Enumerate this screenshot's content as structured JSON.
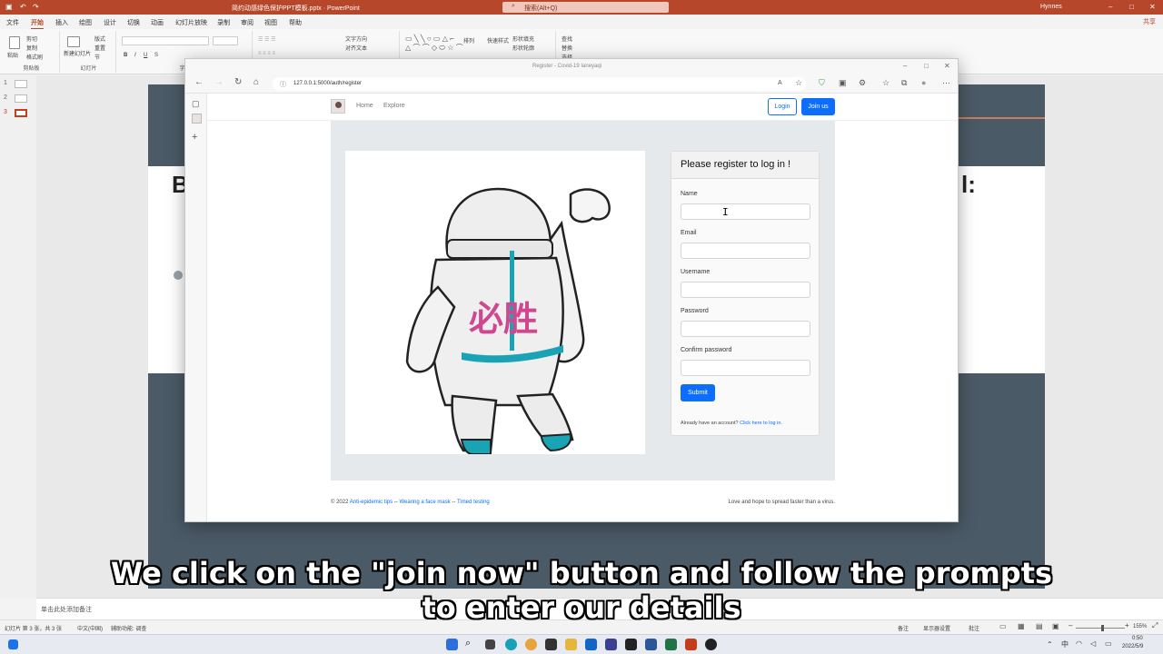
{
  "ppt": {
    "file_title": "简约动感绿色保护PPT模板.pptx  ·  PowerPoint",
    "search_placeholder": "搜索(Alt+Q)",
    "user": "Hynnes",
    "tabs": [
      "文件",
      "开始",
      "插入",
      "绘图",
      "设计",
      "切换",
      "动画",
      "幻灯片放映",
      "录制",
      "审阅",
      "视图",
      "帮助"
    ],
    "active_tab": "开始",
    "share": "共享",
    "ribbon_groups": {
      "clipboard": "剪贴板",
      "slides": "幻灯片",
      "font": "字体"
    },
    "ribbon": {
      "paste": "粘贴",
      "cut": "剪切",
      "copy": "复制",
      "format_painter": "格式刷",
      "new_slide": "新建幻灯片",
      "layout": "版式",
      "reset": "重置",
      "section": "节",
      "find": "查找",
      "replace": "替换",
      "select": "选择",
      "arrange": "排列",
      "quick_styles": "快速样式",
      "text_direction": "文字方向",
      "align_text": "对齐文本",
      "shape_fill": "形状填充",
      "shape_outline": "形状轮廓"
    },
    "slide_numbers": [
      "1",
      "2",
      "3"
    ],
    "slide_partial_left": "B",
    "slide_partial_right": "l:",
    "notes_placeholder": "单击此处添加备注",
    "status_left": "幻灯片 第 3 张，共 3 张",
    "status_lang": "中文(中国)",
    "status_access": "辅助功能: 调查",
    "status_notes": "备注",
    "status_display": "显示器设置",
    "status_comments": "批注",
    "zoom": "155%",
    "clock_time": "0:50",
    "clock_date": "2022/5/9",
    "colors": {
      "titlebar": "#b7472a",
      "slide_dark": "#4a5a66"
    }
  },
  "browser": {
    "window_title": "Register - Covid-19 Ianeyaqi",
    "url": "127.0.0.1:5000/auth/register"
  },
  "site": {
    "nav": {
      "home": "Home",
      "explore": "Explore",
      "login": "Login",
      "join": "Join us"
    },
    "hero_text": "必胜",
    "form": {
      "title": "Please register to log in !",
      "name_label": "Name",
      "email_label": "Email",
      "username_label": "Username",
      "password_label": "Password",
      "confirm_label": "Confirm password",
      "submit": "Submit",
      "already": "Already have an account?",
      "login_link": "Click here to log in."
    },
    "footer": {
      "copyright": "© 2022",
      "link1": "Anti-epidemic tips",
      "sep1": " -- ",
      "link2": "Wearing a face mask",
      "sep2": " -- ",
      "link3": "Timed testing",
      "right": "Love and hope to spread faster than a virus."
    },
    "colors": {
      "primary": "#0d6efd",
      "suit_stripe": "#1aa3b5",
      "hero_text": "#d1478f"
    }
  },
  "subtitle": {
    "line1": "We click on the \"join now\" button and follow the prompts",
    "line2": "to enter our details"
  }
}
